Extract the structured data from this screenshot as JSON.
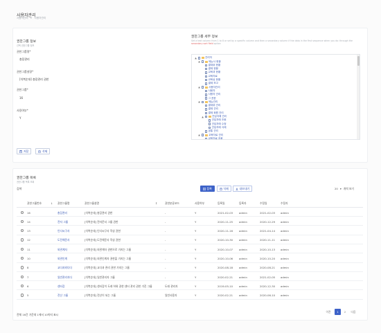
{
  "header": {
    "title": "사용자관리",
    "breadcrumb": [
      "사용자관리",
      ">",
      "사용자관리"
    ]
  },
  "group_info": {
    "title": "권한그룹 정보",
    "subtitle": "선택 권한그룹 정보",
    "fields": [
      {
        "label": "권한그룹명*",
        "value": "총장관리"
      },
      {
        "label": "권한그룹설명*",
        "value": "[석복순대] 총장관리 권한"
      },
      {
        "label": "권한그룹*",
        "value": "16"
      },
      {
        "label": "사용여부*",
        "value": "Y"
      }
    ],
    "save_label": "저장",
    "delete_label": "삭제"
  },
  "group_detail": {
    "title": "권한그룹 세부 정보",
    "hint_1": "Set a text column from 1 to 8 or set by a specific column and then a secondary column if the data in the first sequence",
    "hint_2": "when you do: through the",
    "hint_link": "secondary sort field",
    "hint_3": "option",
    "tree": [
      {
        "toggle": "▲",
        "label": "관리자",
        "level": 0,
        "folder": true
      },
      {
        "toggle": "▲",
        "label": "메뉴사 현황",
        "level": 1,
        "folder": true
      },
      {
        "toggle": "",
        "label": "결재위 현황",
        "level": 2
      },
      {
        "toggle": "",
        "label": "결제 현황",
        "level": 2
      },
      {
        "toggle": "",
        "label": "교육과 현황",
        "level": 2
      },
      {
        "toggle": "",
        "label": "교육자료",
        "level": 2
      },
      {
        "toggle": "",
        "label": "교육상 현황",
        "level": 2
      },
      {
        "toggle": "",
        "label": "결제 보고",
        "level": 2
      },
      {
        "toggle": "▲",
        "label": "사용자관리",
        "level": 1,
        "folder": true
      },
      {
        "toggle": "",
        "label": "사용자",
        "level": 2
      },
      {
        "toggle": "",
        "label": "사용자 관리",
        "level": 2
      },
      {
        "toggle": "",
        "label": "그 권한",
        "level": 2
      },
      {
        "toggle": "▲",
        "label": "메뉴관리",
        "level": 1,
        "folder": true
      },
      {
        "toggle": "",
        "label": "결재위 관리",
        "level": 2
      },
      {
        "toggle": "",
        "label": "결제 관리",
        "level": 2
      },
      {
        "toggle": "",
        "label": "결제 회원 관리",
        "level": 2
      },
      {
        "toggle": "▲",
        "label": "관입자에 관리",
        "level": 2,
        "folder": true
      },
      {
        "toggle": "",
        "label": "관입자에 조회",
        "level": 3
      },
      {
        "toggle": "",
        "label": "관입자에 수정",
        "level": 3
      },
      {
        "toggle": "",
        "label": "관입자에 삭제",
        "level": 3
      },
      {
        "toggle": "",
        "label": "공통 관리",
        "level": 2
      },
      {
        "toggle": "▲",
        "label": "교육자료 관리",
        "level": 1,
        "folder": true
      },
      {
        "toggle": "",
        "label": "교육자료 조회",
        "level": 2
      }
    ]
  },
  "group_list": {
    "title": "권한그룹 목록",
    "subtitle": "권한그룹 목록 조회",
    "search_label": "검색",
    "add_label": "등록",
    "delete_label": "삭제",
    "export_label": "내보내기",
    "page_size": "20",
    "page_size_suffix": "개씩 보기",
    "columns": [
      "권한그룹번호",
      "권한그룹명",
      "권한그룹설명",
      "권한분류코드",
      "사용여부",
      "등록일",
      "등록자",
      "수정일",
      "수정자"
    ],
    "rows": [
      [
        "16",
        "총장관리",
        "[석복순대] 총장관리 권한",
        "-",
        "Y",
        "2021-02-03",
        "admin",
        "2021-02-03",
        "admin"
      ],
      [
        "14",
        "전자 그룹",
        "[석복순대] 전자문서 그룹 권한",
        "-",
        "Y",
        "2020-11-25",
        "admin",
        "2020-12-29",
        "admin"
      ],
      [
        "13",
        "인디씨구사",
        "[석복순대] 인디씨구사 작성 권한",
        "-",
        "Y",
        "2020-11-16",
        "admin",
        "2021-04-14",
        "admin"
      ],
      [
        "12",
        "도전해문사",
        "[석복순대] 도전해문사 작성 권한",
        "-",
        "Y",
        "2020-10-30",
        "admin",
        "2020-11-11",
        "admin"
      ],
      [
        "11",
        "외관계자",
        "[석복순대] 외관계자 권한으로 가지는 그룹",
        "-",
        "Y",
        "2020-10-07",
        "admin",
        "2020-10-13",
        "admin"
      ],
      [
        "10",
        "외관인계",
        "[석복순대] 외관인계자 권한을 가지는 그룹",
        "-",
        "Y",
        "2020-10-06",
        "admin",
        "2020-10-20",
        "admin"
      ],
      [
        "8",
        "교다과외다다",
        "[석복순대] 교다과 관리 권한 가지는 그룹",
        "-",
        "Y",
        "2020-08-18",
        "admin",
        "2020-08-21",
        "admin"
      ],
      [
        "7",
        "일반관리자다",
        "[석복순대] 일반관리자 그룹",
        "-",
        "Y",
        "2020-02-21",
        "admin",
        "2021-02-05",
        "admin"
      ],
      [
        "6",
        "센터장",
        "[석복순대] 센터장이 도래 하위 권한 센터 관리 권한 가진 그룹",
        "도래 관리자",
        "Y",
        "2019-05-10",
        "admin",
        "2020-12-30",
        "admin"
      ],
      [
        "5",
        "전산 그룹",
        "[석복순대] 전산이 되는 그룹",
        "일반사용자",
        "Y",
        "2020-02-21",
        "admin",
        "2020-06-10",
        "admin"
      ]
    ],
    "footer": "전체 16건 가운데 1에서 10까지 표시",
    "pagination": [
      "이전",
      "1",
      "2",
      "다음"
    ],
    "active_page": "1"
  },
  "colors": {
    "accent": "#3d62c8",
    "link": "#3b5bb5",
    "folder": "#f3c35c"
  }
}
